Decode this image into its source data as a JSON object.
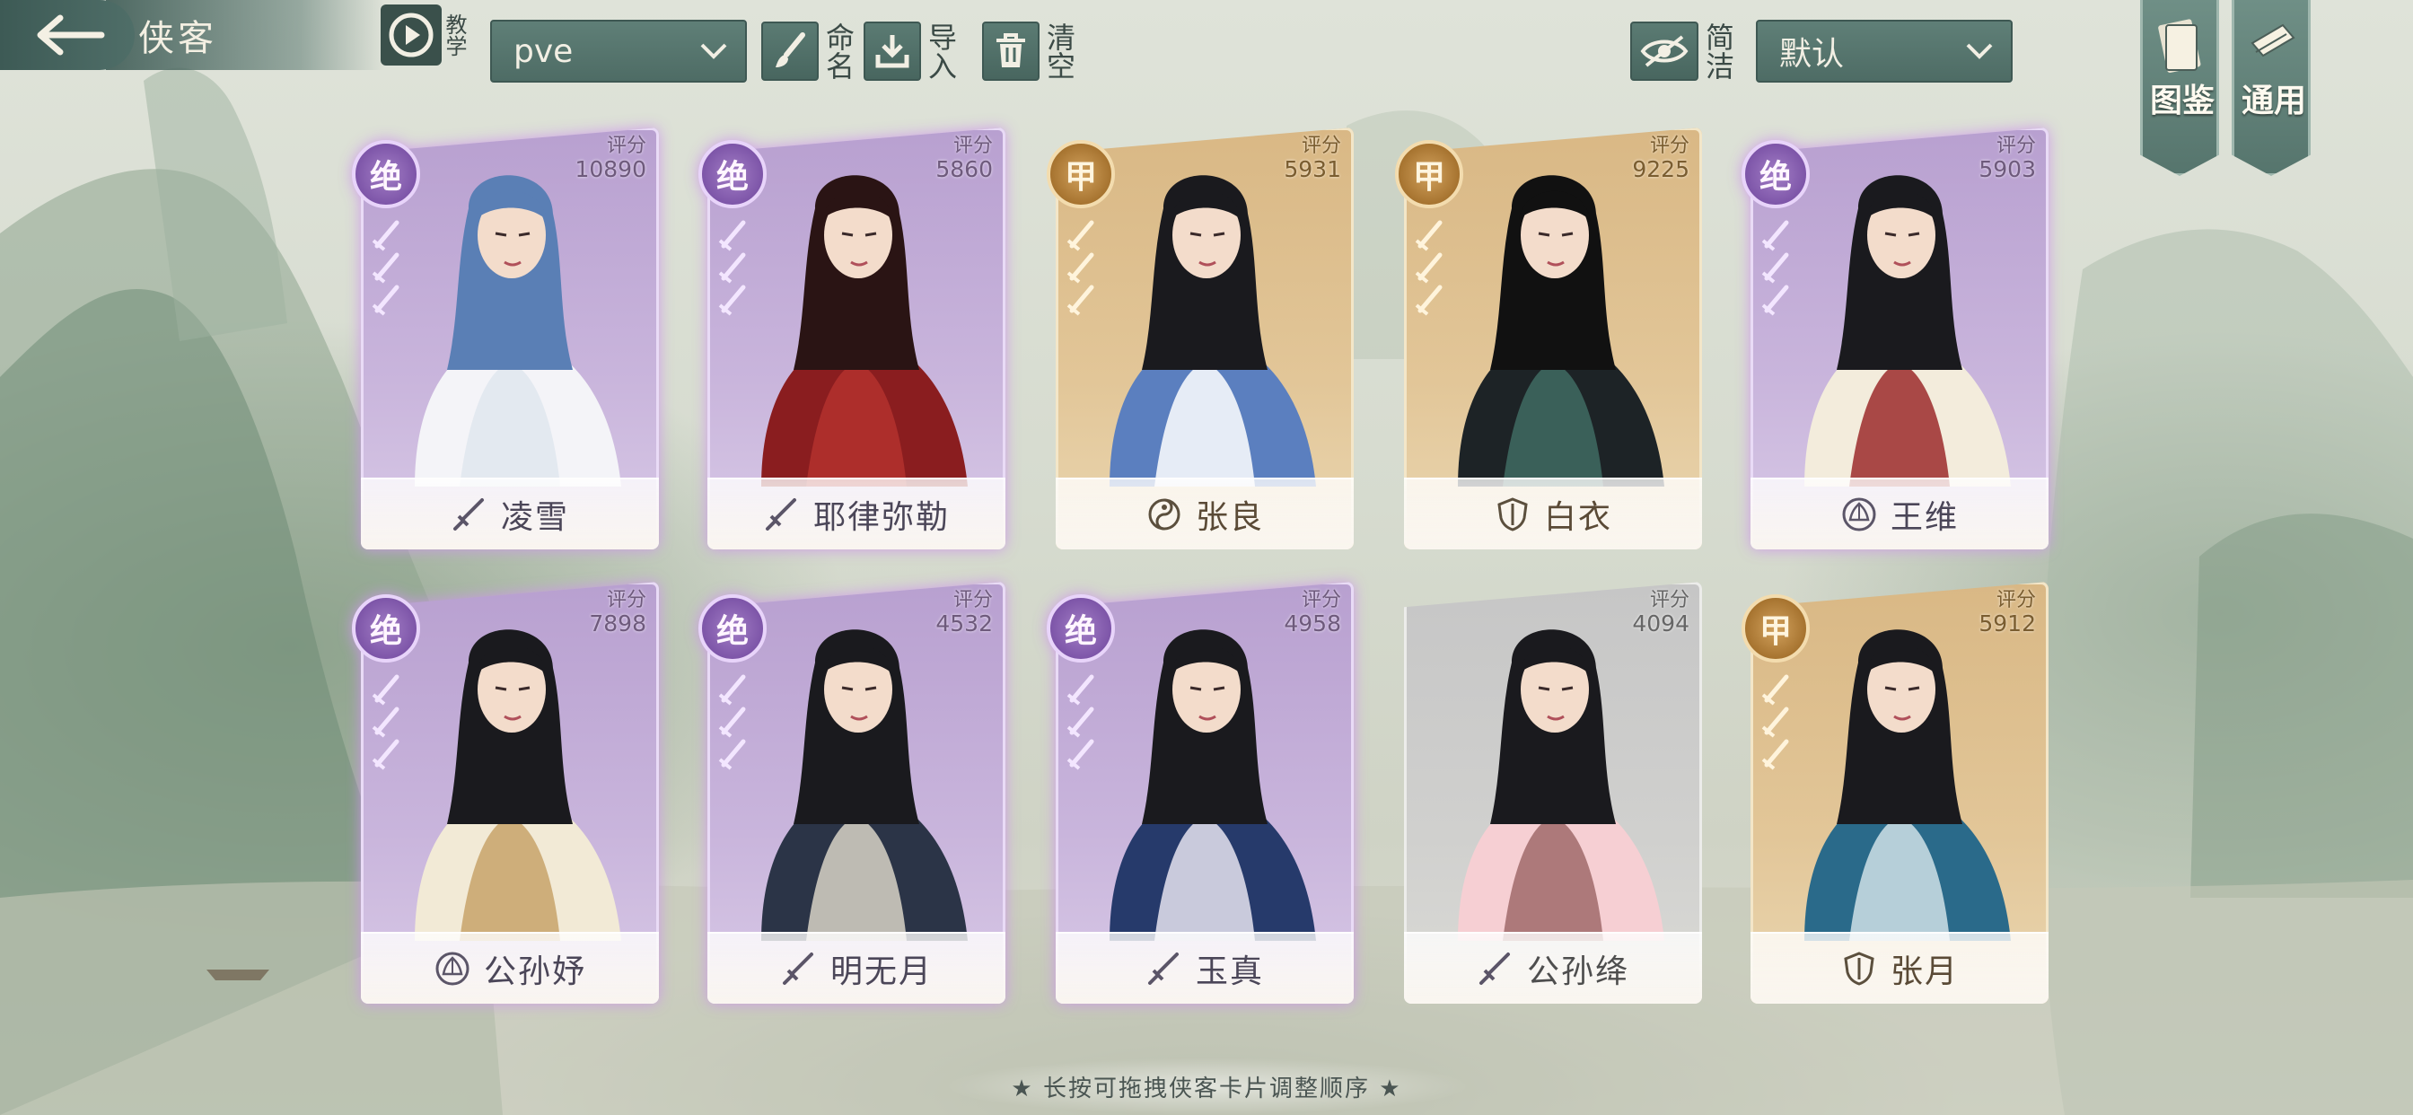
{
  "header": {
    "title": "侠客",
    "tutorial_label": "教学",
    "preset_select_value": "pve",
    "rename_label": "命名",
    "import_label": "导入",
    "clear_label": "清空",
    "concise_label": "简洁",
    "sort_select_value": "默认"
  },
  "corner_tabs": {
    "codex_label": "图鉴",
    "general_label": "通用"
  },
  "score_label": "评分",
  "cards": [
    {
      "name": "凌雪",
      "score": "10890",
      "rank": "绝",
      "rarity": "purple",
      "role_icon": "sword-icon"
    },
    {
      "name": "耶律弥勒",
      "score": "5860",
      "rank": "绝",
      "rarity": "purple",
      "role_icon": "sword-icon"
    },
    {
      "name": "张良",
      "score": "5931",
      "rank": "甲",
      "rarity": "gold",
      "role_icon": "taiji-icon"
    },
    {
      "name": "白衣",
      "score": "9225",
      "rank": "甲",
      "rarity": "gold",
      "role_icon": "shield-icon"
    },
    {
      "name": "王维",
      "score": "5903",
      "rank": "绝",
      "rarity": "purple",
      "role_icon": "lotus-icon"
    },
    {
      "name": "公孙妤",
      "score": "7898",
      "rank": "绝",
      "rarity": "purple",
      "role_icon": "lotus-icon"
    },
    {
      "name": "明无月",
      "score": "4532",
      "rank": "绝",
      "rarity": "purple",
      "role_icon": "sword-icon"
    },
    {
      "name": "玉真",
      "score": "4958",
      "rank": "绝",
      "rarity": "purple",
      "role_icon": "sword-icon"
    },
    {
      "name": "公孙绛",
      "score": "4094",
      "rank": "",
      "rarity": "gray",
      "role_icon": "sword-icon"
    },
    {
      "name": "张月",
      "score": "5912",
      "rank": "甲",
      "rarity": "gold",
      "role_icon": "shield-icon"
    }
  ],
  "footer_hint": "★ 长按可拖拽侠客卡片调整顺序 ★",
  "colors": {
    "ui_teal": "#4e6c65",
    "purple_card": "#c9b5dc",
    "gold_card": "#e2c698",
    "gray_card": "#d0d0ce"
  }
}
